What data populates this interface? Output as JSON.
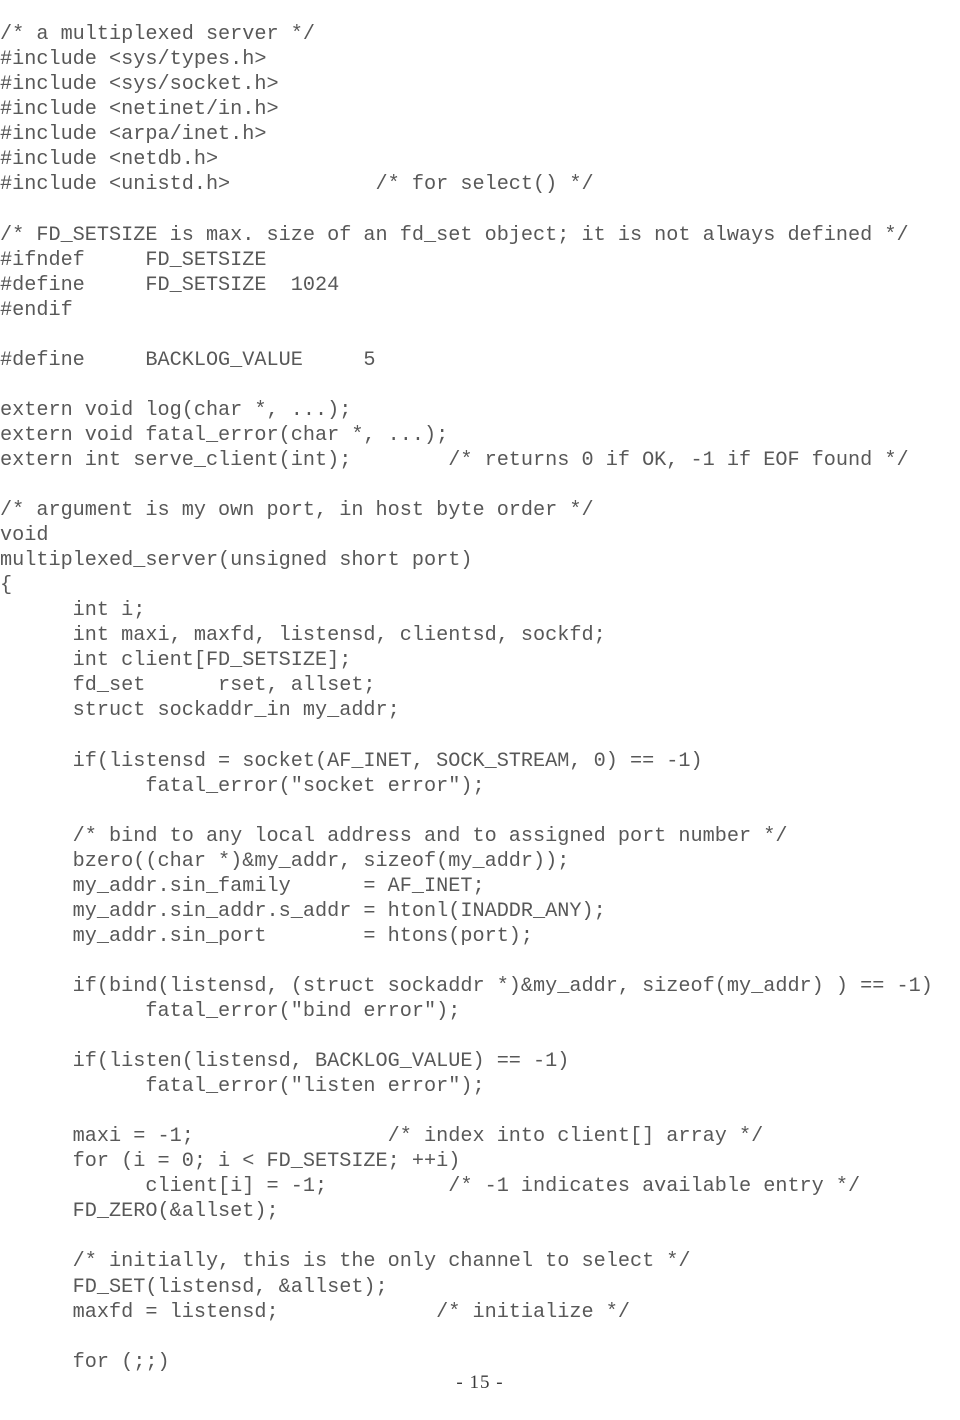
{
  "document": {
    "page_number_label": "- 15 -",
    "language": "C",
    "text_color": "#585858",
    "background_color": "#ffffff"
  },
  "code": {
    "lines": [
      "/* a multiplexed server */",
      "#include <sys/types.h>",
      "#include <sys/socket.h>",
      "#include <netinet/in.h>",
      "#include <arpa/inet.h>",
      "#include <netdb.h>",
      "#include <unistd.h>            /* for select() */",
      "",
      "/* FD_SETSIZE is max. size of an fd_set object; it is not always defined */",
      "#ifndef     FD_SETSIZE",
      "#define     FD_SETSIZE  1024",
      "#endif",
      "",
      "#define     BACKLOG_VALUE     5",
      "",
      "extern void log(char *, ...);",
      "extern void fatal_error(char *, ...);",
      "extern int serve_client(int);        /* returns 0 if OK, -1 if EOF found */",
      "",
      "/* argument is my own port, in host byte order */",
      "void",
      "multiplexed_server(unsigned short port)",
      "{",
      "      int i;",
      "      int maxi, maxfd, listensd, clientsd, sockfd;",
      "      int client[FD_SETSIZE];",
      "      fd_set      rset, allset;",
      "      struct sockaddr_in my_addr;",
      "",
      "      if(listensd = socket(AF_INET, SOCK_STREAM, 0) == -1)",
      "            fatal_error(\"socket error\");",
      "",
      "      /* bind to any local address and to assigned port number */",
      "      bzero((char *)&my_addr, sizeof(my_addr));",
      "      my_addr.sin_family      = AF_INET;",
      "      my_addr.sin_addr.s_addr = htonl(INADDR_ANY);",
      "      my_addr.sin_port        = htons(port);",
      "",
      "      if(bind(listensd, (struct sockaddr *)&my_addr, sizeof(my_addr) ) == -1)",
      "            fatal_error(\"bind error\");",
      "",
      "      if(listen(listensd, BACKLOG_VALUE) == -1)",
      "            fatal_error(\"listen error\");",
      "",
      "      maxi = -1;                /* index into client[] array */",
      "      for (i = 0; i < FD_SETSIZE; ++i)",
      "            client[i] = -1;          /* -1 indicates available entry */",
      "      FD_ZERO(&allset);",
      "",
      "      /* initially, this is the only channel to select */",
      "      FD_SET(listensd, &allset);",
      "      maxfd = listensd;             /* initialize */",
      "",
      "      for (;;)"
    ]
  }
}
